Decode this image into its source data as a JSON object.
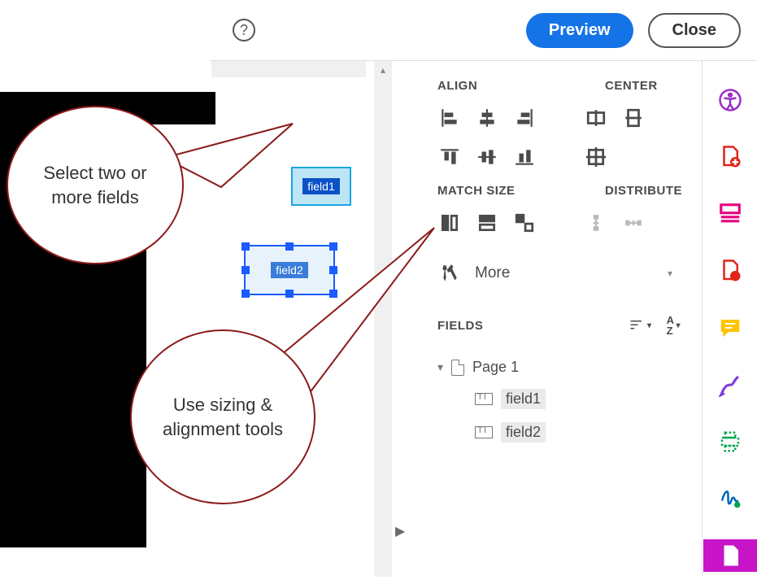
{
  "topbar": {
    "preview_label": "Preview",
    "close_label": "Close"
  },
  "callouts": {
    "select_fields": "Select two or more fields",
    "sizing_tools": "Use sizing & alignment tools"
  },
  "canvas": {
    "field1_label": "field1",
    "field2_label": "field2"
  },
  "panel": {
    "align_title": "ALIGN",
    "center_title": "CENTER",
    "match_size_title": "MATCH SIZE",
    "distribute_title": "DISTRIBUTE",
    "more_label": "More",
    "fields_title": "FIELDS",
    "page_label": "Page 1",
    "tree": {
      "field1": "field1",
      "field2": "field2"
    }
  }
}
